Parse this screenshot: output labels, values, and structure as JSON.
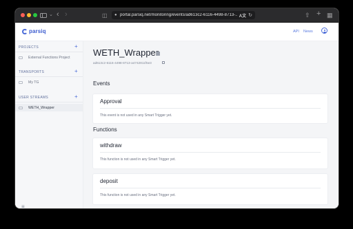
{
  "browser": {
    "url": "portal.parsiq.net/monitoring/events/ad613c2-6116-4498-8713-...",
    "translate_label": "A文"
  },
  "header": {
    "logo_text": "parsiq",
    "links": {
      "api": "API",
      "news": "News"
    }
  },
  "sidebar": {
    "sections": [
      {
        "title": "PROJECTS",
        "items": [
          {
            "label": "External Functions Project",
            "active": false
          }
        ]
      },
      {
        "title": "TRANSPORTS",
        "items": [
          {
            "label": "My TG",
            "active": false
          }
        ]
      },
      {
        "title": "USER STREAMS",
        "items": [
          {
            "label": "WETH_Wrapper",
            "active": true
          }
        ]
      }
    ]
  },
  "main": {
    "title": "WETH_Wrapper",
    "stream_id": "ad613c2-6116-4498-8713-a4742811f5e3",
    "events_heading": "Events",
    "functions_heading": "Functions",
    "events": [
      {
        "name": "Approval",
        "note": "This event is not used in any Smart Trigger yet."
      }
    ],
    "functions": [
      {
        "name": "withdraw",
        "note": "This function is not used in any Smart Trigger yet."
      },
      {
        "name": "deposit",
        "note": "This function is not used in any Smart Trigger yet."
      }
    ]
  },
  "colors": {
    "brand": "#3b5bcf",
    "sidebar_bg": "#f6f7f9",
    "main_bg": "#f4f5f7"
  }
}
